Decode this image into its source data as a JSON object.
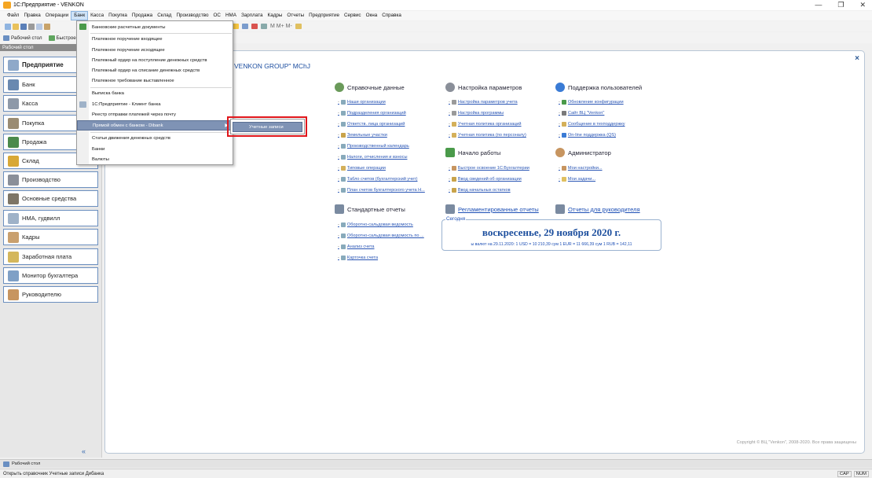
{
  "window": {
    "title": "1С:Предприятие - VENKON",
    "minimize": "—",
    "restore": "❐",
    "close": "✕"
  },
  "menubar": [
    "Файл",
    "Правка",
    "Операции",
    "Банк",
    "Касса",
    "Покупка",
    "Продажа",
    "Склад",
    "Производство",
    "ОС",
    "НМА",
    "Зарплата",
    "Кадры",
    "Отчеты",
    "Предприятие",
    "Сервис",
    "Окна",
    "Справка"
  ],
  "toolbar2": {
    "desktop": "Рабочий стол",
    "quick": "Быстрое"
  },
  "toolbar_right": "M M+ M-",
  "left_panel": {
    "header": "Рабочий стол",
    "items": [
      "Предприятие",
      "Банк",
      "Касса",
      "Покупка",
      "Продажа",
      "Склад",
      "Производство",
      "Основные средства",
      "НМА, гудвилл",
      "Кадры",
      "Заработная плата",
      "Монитор бухгалтера",
      "Руководителю"
    ],
    "footer": "«"
  },
  "main": {
    "close": "×",
    "org_title": "VENKON GROUP\" MChJ",
    "sections": {
      "ref": {
        "title": "Справочные данные",
        "links": [
          "Наши организации",
          "Подразделения организаций",
          "Ответств. лица организаций",
          "Земельные участки",
          "Производственный календарь",
          "Налоги, отчисления и взносы",
          "Типовые операции",
          "Табло счетов (бухгалтерский учет)",
          "План счетов бухгалтерского учета Н..."
        ]
      },
      "settings": {
        "title": "Настройка параметров",
        "links": [
          "Настройка параметров учета",
          "Настройка программы",
          "Учетная политика организаций",
          "Учетная политика (по персоналу)"
        ]
      },
      "support": {
        "title": "Поддержка пользователей",
        "links": [
          "Обновление конфигурации",
          "Сайт ВЦ \"Venkon\"",
          "Сообщение в техподдержку",
          "On-line поддержка (QS)"
        ]
      },
      "start": {
        "title": "Начало работы",
        "links": [
          "Быстрое освоение 1С:Бухгалтерии",
          "Ввод сведений об организации",
          "Ввод начальных остатков"
        ]
      },
      "admin": {
        "title": "Администратор",
        "links": [
          "Мои настройки...",
          "Мои задачи..."
        ]
      },
      "std_reports": {
        "title": "Стандартные отчеты",
        "links": [
          "Оборотно-сальдовая ведомость",
          "Оборотно-сальдовая ведомость по ...",
          "Анализ счета",
          "Карточка счета"
        ]
      },
      "reg_reports": {
        "title": "Регламентированные отчеты"
      },
      "mgr_reports": {
        "title": "Отчеты для руководителя"
      }
    },
    "today": {
      "label": "Сегодня",
      "date": "воскресенье, 29 ноября 2020 г.",
      "rates": "ы валют на 29.11.2020:   1 USD = 10 210,39 сум    1 EUR = 11 666,39 сум    1 RUB = 142,11"
    },
    "copyright": "Copyright © ВЦ \"Venkon\", 2008-2020. Все права защищены"
  },
  "dropdown": {
    "items": [
      "Банковские расчетные документы",
      "Платежное поручение входящее",
      "Платежное поручение исходящее",
      "Платежный ордер на поступление денежных средств",
      "Платежный ордер на списание денежных средств",
      "Платежное требование выставленное",
      "Выписка банка",
      "1С:Предприятие - Клиент банка",
      "Реестр отправки платежей через почту",
      "Прямой обмен с банком - Dibank",
      "Статьи движения денежных средств",
      "Банки",
      "Валюты"
    ],
    "submenu": "Учетные записи",
    "arrow": "▶"
  },
  "tabbar": {
    "tab": "Рабочий стол"
  },
  "status": {
    "text": "Открыть справочник Учетные записи Дибанка",
    "cap": "CAP",
    "num": "NUM"
  },
  "colors": {
    "accent": "#1d4fb5",
    "highlight": "#7f93b5",
    "redbox": "#e0161b"
  }
}
